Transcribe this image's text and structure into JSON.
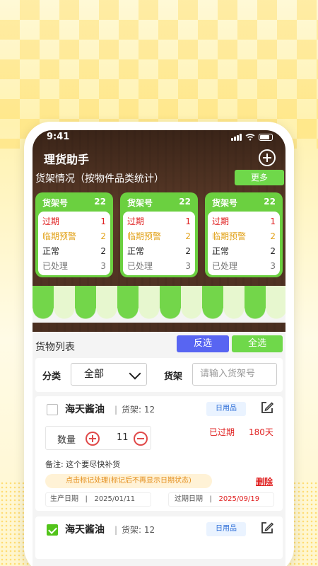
{
  "status": {
    "time": "9:41"
  },
  "app": {
    "title": "理货助手"
  },
  "summary": {
    "title": "货架情况（按物件品类统计）",
    "more_label": "更多",
    "shelves": [
      {
        "label": "货架号",
        "count": "22",
        "rows": [
          {
            "label": "过期",
            "value": "1"
          },
          {
            "label": "临期预警",
            "value": "2"
          },
          {
            "label": "正常",
            "value": "2"
          },
          {
            "label": "已处理",
            "value": "3"
          }
        ]
      },
      {
        "label": "货架号",
        "count": "22",
        "rows": [
          {
            "label": "过期",
            "value": "1"
          },
          {
            "label": "临期预警",
            "value": "2"
          },
          {
            "label": "正常",
            "value": "2"
          },
          {
            "label": "已处理",
            "value": "3"
          }
        ]
      },
      {
        "label": "货架号",
        "count": "22",
        "rows": [
          {
            "label": "过期",
            "value": "1"
          },
          {
            "label": "临期预警",
            "value": "2"
          },
          {
            "label": "正常",
            "value": "2"
          },
          {
            "label": "已处理",
            "value": "3"
          }
        ]
      }
    ]
  },
  "list": {
    "title": "货物列表",
    "invert_label": "反选",
    "select_all_label": "全选"
  },
  "filter": {
    "category_label": "分类",
    "category_value": "全部",
    "shelf_label": "货架",
    "shelf_placeholder": "请输入货架号"
  },
  "items": [
    {
      "name": "海天酱油",
      "shelf_label": "货架:",
      "shelf_value": "12",
      "tag": "日用品",
      "qty_label": "数量",
      "qty_value": "11",
      "status": "已过期",
      "days": "180天",
      "note": "备注: 这个要尽快补货",
      "hint": "点击标记处理(标记后不再显示日期状态)",
      "delete_label": "删除",
      "prod_label": "生产日期",
      "prod_date": "2025/01/11",
      "exp_label": "过期日期",
      "exp_date": "2025/09/19",
      "checked": false
    },
    {
      "name": "海天酱油",
      "shelf_label": "货架:",
      "shelf_value": "12",
      "tag": "日用品",
      "checked": true
    }
  ],
  "colors": {
    "green": "#6fd84a",
    "blue": "#5865f2",
    "red": "#e02020",
    "orange": "#e2a21a"
  }
}
